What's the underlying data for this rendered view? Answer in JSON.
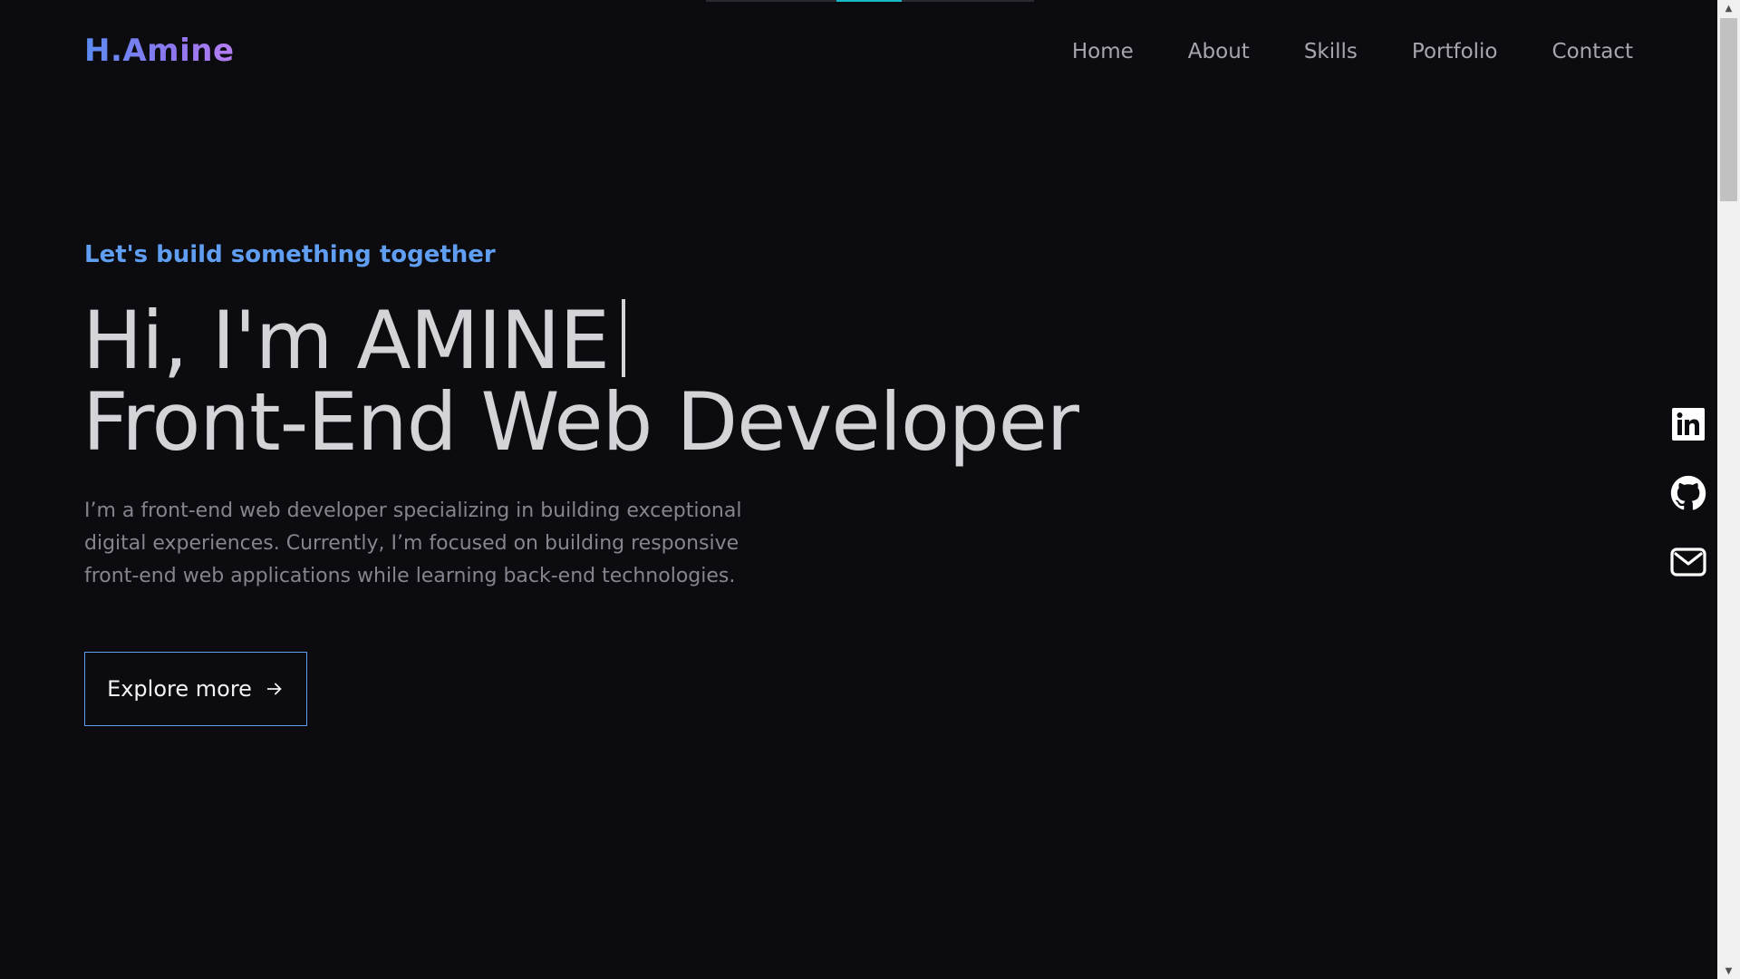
{
  "header": {
    "logo": "H.Amine",
    "nav": [
      "Home",
      "About",
      "Skills",
      "Portfolio",
      "Contact"
    ]
  },
  "hero": {
    "tagline": "Let's build something together",
    "title_line1": "Hi, I'm AMINE",
    "title_line2": "Front-End Web Developer",
    "description": "I’m a front-end web developer specializing in building exceptional digital experiences. Currently, I’m focused on building responsive front-end web applications while learning back-end technologies.",
    "cta_label": "Explore more"
  },
  "social": {
    "icons": [
      "linkedin-icon",
      "github-icon",
      "mail-icon"
    ]
  },
  "theme": {
    "background": "#0b0b10",
    "accent": "#5f9ef0",
    "progress_accent": "#19b8c7"
  },
  "scrollbar": {
    "up_glyph": "▲",
    "down_glyph": "▼"
  }
}
